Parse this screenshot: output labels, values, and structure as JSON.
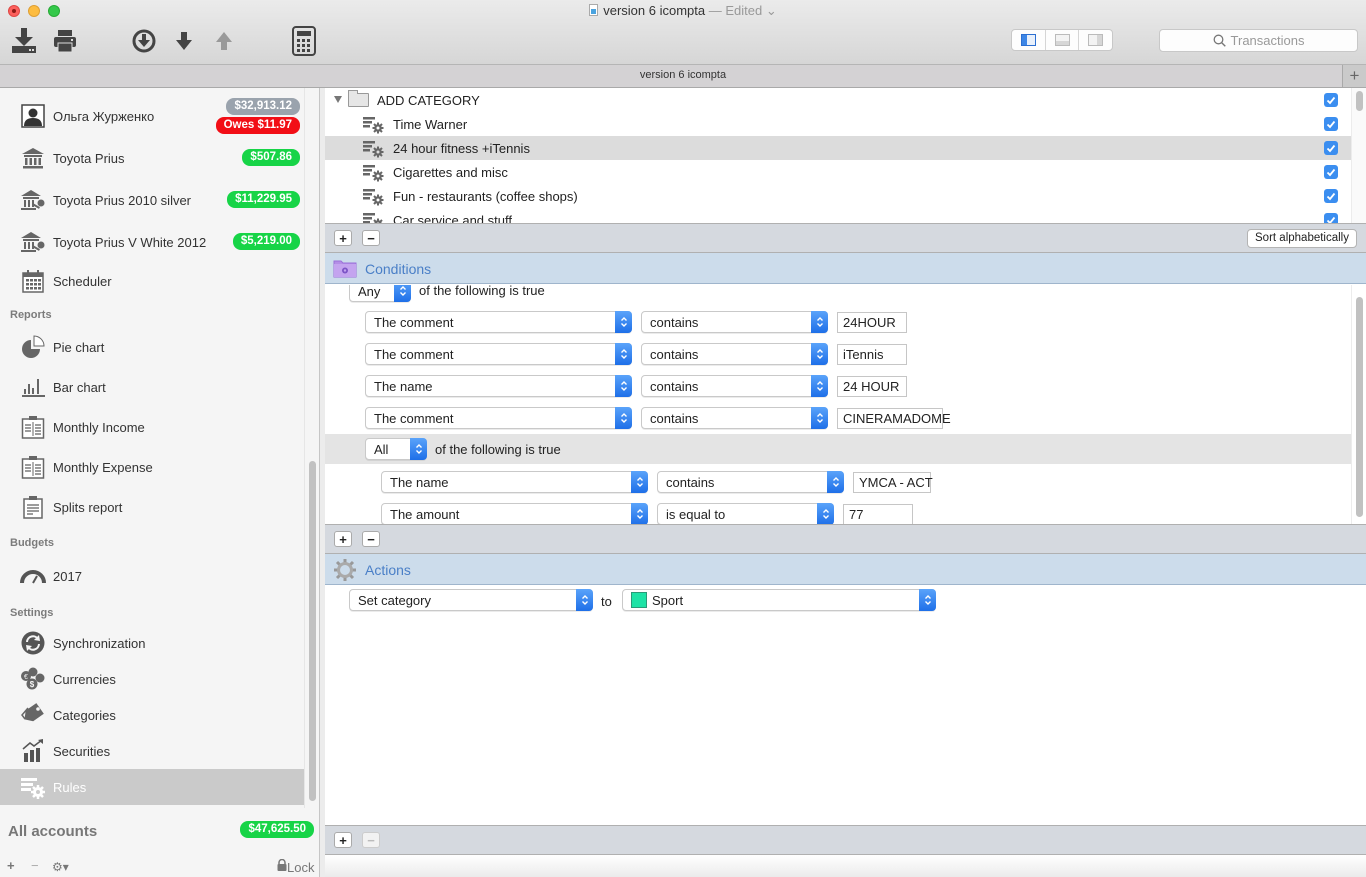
{
  "window": {
    "title": "version 6 icompta",
    "edited_label": "— Edited",
    "tab_title": "version 6 icompta"
  },
  "toolbar": {
    "search_placeholder": "Transactions",
    "buttons": [
      "import-icon",
      "print-icon",
      "download-circle-icon",
      "arrow-down-icon",
      "arrow-up-icon",
      "calculator-icon"
    ],
    "view_segments": [
      "sidebar-left-view",
      "bottom-pane-view",
      "sidebar-right-view"
    ]
  },
  "sidebar": {
    "accounts": [
      {
        "label": "Ольга Журженко",
        "icon": "person-icon",
        "balance": "$32,913.12",
        "balance_color": "#9aa3ad",
        "owes": "Owes $11.97",
        "owes_color": "#f20e16"
      },
      {
        "label": "Toyota Prius",
        "icon": "bank-icon",
        "balance": "$507.86",
        "balance_color": "#17d447"
      },
      {
        "label": "Toyota Prius 2010 silver",
        "icon": "bank-key-icon",
        "balance": "$11,229.95",
        "balance_color": "#17d447"
      },
      {
        "label": "Toyota Prius V White 2012",
        "icon": "bank-key-icon",
        "balance": "$5,219.00",
        "balance_color": "#17d447"
      },
      {
        "label": "Scheduler",
        "icon": "calendar-icon"
      }
    ],
    "sections": {
      "reports": "Reports",
      "budgets": "Budgets",
      "settings": "Settings"
    },
    "reports": [
      {
        "label": "Pie chart",
        "icon": "pie-chart-icon"
      },
      {
        "label": "Bar chart",
        "icon": "bar-chart-icon"
      },
      {
        "label": "Monthly Income",
        "icon": "clipboard-report-icon"
      },
      {
        "label": "Monthly Expense",
        "icon": "clipboard-report-icon"
      },
      {
        "label": "Splits report",
        "icon": "clipboard-icon"
      }
    ],
    "budgets": [
      {
        "label": "2017",
        "icon": "gauge-icon"
      }
    ],
    "settings": [
      {
        "label": "Synchronization",
        "icon": "sync-icon"
      },
      {
        "label": "Currencies",
        "icon": "currencies-icon"
      },
      {
        "label": "Categories",
        "icon": "tag-icon"
      },
      {
        "label": "Securities",
        "icon": "securities-icon"
      },
      {
        "label": "Rules",
        "icon": "rules-icon",
        "selected": true
      }
    ],
    "all_accounts_label": "All accounts",
    "all_accounts_balance": "$47,625.50",
    "footer": {
      "add": "+",
      "remove": "−",
      "gear": "⚙▾",
      "lock": "Lock"
    }
  },
  "rules": {
    "group": "ADD CATEGORY",
    "items": [
      {
        "label": "Time Warner",
        "checked": true
      },
      {
        "label": "24 hour fitness +iTennis",
        "checked": true,
        "selected": true
      },
      {
        "label": "Cigarettes and misc",
        "checked": true
      },
      {
        "label": "Fun - restaurants (coffee shops)",
        "checked": true
      },
      {
        "label": "Car service and stuff",
        "checked": true
      }
    ],
    "sort_button": "Sort alphabetically",
    "add_label": "+",
    "remove_label": "−"
  },
  "conditions": {
    "title": "Conditions",
    "match_mode": "Any",
    "match_suffix": "of the following is true",
    "rows": [
      {
        "field": "The comment",
        "operator": "contains",
        "value": "24HOUR"
      },
      {
        "field": "The comment",
        "operator": "contains",
        "value": "iTennis"
      },
      {
        "field": "The name",
        "operator": "contains",
        "value": "24 HOUR"
      },
      {
        "field": "The comment",
        "operator": "contains",
        "value": "CINERAMADOME"
      }
    ],
    "subgroup": {
      "match_mode": "All",
      "match_suffix": "of the following is true",
      "rows": [
        {
          "field": "The name",
          "operator": "contains",
          "value": "YMCA - ACT"
        },
        {
          "field": "The amount",
          "operator": "is equal to",
          "value": "77"
        }
      ]
    }
  },
  "actions": {
    "title": "Actions",
    "rows": [
      {
        "action": "Set category",
        "to_label": "to",
        "target": "Sport",
        "target_color": "#1ee3a6"
      }
    ]
  }
}
